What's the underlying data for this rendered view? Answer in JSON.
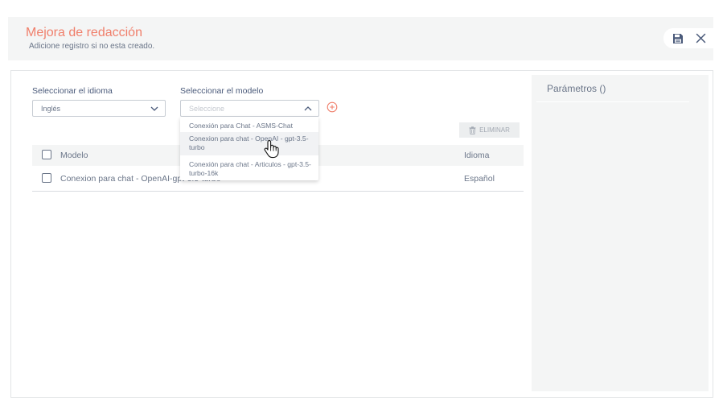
{
  "header": {
    "title": "Mejora de redacción",
    "subtitle": "Adicione registro si no esta creado."
  },
  "form": {
    "language_label": "Seleccionar el idioma",
    "language_value": "Inglés",
    "model_label": "Seleccionar el modelo",
    "model_placeholder": "Seleccione"
  },
  "dropdown": {
    "options": [
      "Conexión para Chat - ASMS-Chat",
      "Conexion para chat - OpenAI - gpt-3.5-turbo",
      "Conexión para chat - Articulos - gpt-3.5-turbo-16k"
    ],
    "hovered_index": 1
  },
  "toolbar": {
    "delete_label": "ELIMINAR"
  },
  "table": {
    "columns": [
      "Modelo",
      "Idioma"
    ],
    "rows": [
      {
        "model": "Conexion para chat - OpenAI-gpt-3.5-turbo",
        "language": "Español"
      }
    ]
  },
  "params": {
    "title": "Parámetros ()"
  },
  "colors": {
    "accent": "#f07f6b",
    "text": "#6b7689",
    "panel_bg": "#f4f5f5"
  }
}
